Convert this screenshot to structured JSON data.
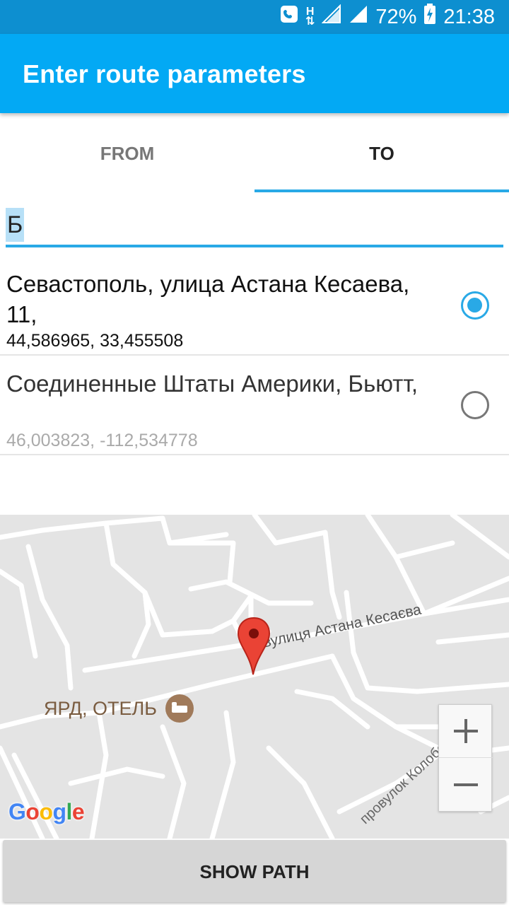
{
  "status_bar": {
    "battery": "72%",
    "time": "21:38",
    "network_type": "H",
    "icons": [
      "phone-call-icon",
      "data-h-icon",
      "signal-icon",
      "signal-icon",
      "battery-charging-icon"
    ]
  },
  "app_bar": {
    "title": "Enter route parameters"
  },
  "tabs": [
    {
      "label": "FROM",
      "selected": false
    },
    {
      "label": "TO",
      "selected": true
    }
  ],
  "search": {
    "value": "Б"
  },
  "results": [
    {
      "address": "Севастополь, улица Астана Кесаева, 11,",
      "coords": "44,586965, 33,455508",
      "selected": true
    },
    {
      "address": "Соединенные Штаты Америки, Бьютт,",
      "coords": "46,003823, -112,534778",
      "selected": false
    }
  ],
  "map": {
    "street_label": "вулиця Астана Кесаєва",
    "lane_label": "провулок Колобова",
    "poi_label": "ЯРД, ОТЕЛЬ",
    "logo": {
      "l1": "G",
      "l2": "o",
      "l3": "o",
      "l4": "g",
      "l5": "l",
      "l6": "e"
    },
    "colors": {
      "background": "#e4e4e4",
      "roads": "#ffffff",
      "marker": "#ea4335"
    }
  },
  "actions": {
    "show_path_label": "SHOW PATH"
  },
  "colors": {
    "accent": "#03a9f4",
    "status_bar": "#0d8fd0",
    "indicator": "#29a9e6"
  }
}
